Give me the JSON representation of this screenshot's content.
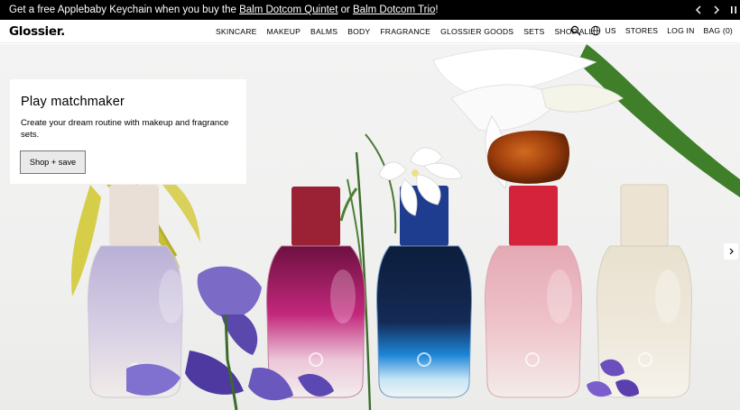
{
  "promo": {
    "prefix": "Get a free Applebaby Keychain when you buy the ",
    "link1": "Balm Dotcom Quintet",
    "middle": " or ",
    "link2": "Balm Dotcom Trio",
    "suffix": "!"
  },
  "promo_controls": [
    "chevron-left-icon",
    "chevron-right-icon",
    "pause-icon"
  ],
  "brand": {
    "logo": "Glossier."
  },
  "nav": {
    "links": [
      "SKINCARE",
      "MAKEUP",
      "BALMS",
      "BODY",
      "FRAGRANCE",
      "GLOSSIER GOODS",
      "SETS",
      "SHOP ALL"
    ],
    "region": "US",
    "stores": "STORES",
    "login": "LOG IN",
    "bag": "BAG (0)"
  },
  "hero": {
    "title": "Play matchmaker",
    "description": "Create your dream routine with makeup and fragrance sets.",
    "cta": "Shop + save",
    "bottles": [
      "lavender",
      "magenta",
      "navy-blue",
      "pink",
      "cream"
    ],
    "colors": {
      "magenta_cap": "#9b2234",
      "navy_cap": "#1f3d8e",
      "pink_cap": "#d6233c",
      "cream_cap": "#ece3d3",
      "amber_stone": "#a0410d"
    }
  }
}
